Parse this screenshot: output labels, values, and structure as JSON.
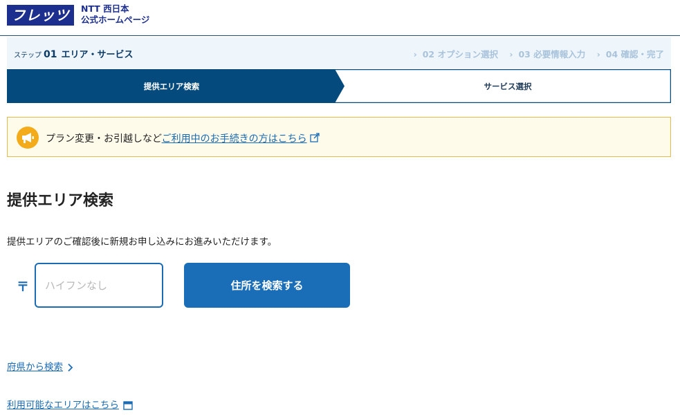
{
  "header": {
    "logo_text": "フレッツ",
    "brand_line1": "NTT 西日本",
    "brand_line2": "公式ホームページ"
  },
  "stepbar": {
    "current_prefix": "ステップ",
    "current_number": "01",
    "current_name": "エリア・サービス",
    "next_steps": [
      "02 オプション選択",
      "03 必要情報入力",
      "04 確認・完了"
    ]
  },
  "tabs": {
    "active_label": "提供エリア検索",
    "inactive_label": "サービス選択"
  },
  "notice": {
    "text": "プラン変更・お引越しなど",
    "link_text": "ご利用中のお手続きの方はこちら"
  },
  "main": {
    "title": "提供エリア検索",
    "description": "提供エリアのご確認後に新規お申し込みにお進みいただけます。",
    "postal_mark": "〒",
    "zip_placeholder": "ハイフンなし",
    "search_button": "住所を検索する",
    "link_prefecture": "府県から検索",
    "link_available_area": "利用可能なエリアはこちら"
  },
  "colors": {
    "brand_navy": "#1c2e8e",
    "active_tab": "#054a7c",
    "primary_blue": "#1a6eb8",
    "notice_bg": "#fffbea",
    "notice_border": "#e5b94a",
    "notice_icon": "#f4ab1a"
  }
}
